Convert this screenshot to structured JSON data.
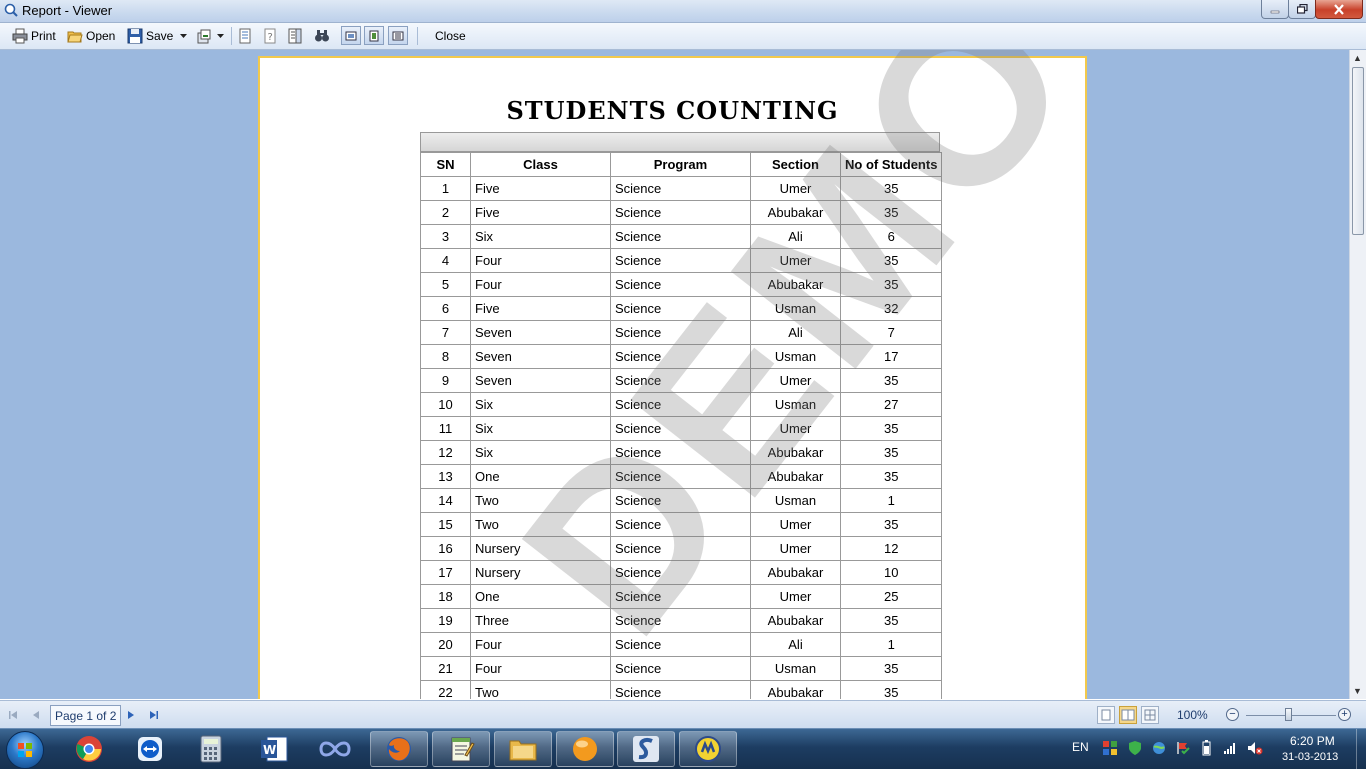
{
  "window": {
    "title": "Report - Viewer"
  },
  "toolbar": {
    "print_label": "Print",
    "open_label": "Open",
    "save_label": "Save",
    "close_label": "Close"
  },
  "report": {
    "title": "STUDENTS COUNTING",
    "columns": [
      "SN",
      "Class",
      "Program",
      "Section",
      "No of Students"
    ],
    "rows": [
      [
        "1",
        "Five",
        "Science",
        "Umer",
        "35"
      ],
      [
        "2",
        "Five",
        "Science",
        "Abubakar",
        "35"
      ],
      [
        "3",
        "Six",
        "Science",
        "Ali",
        "6"
      ],
      [
        "4",
        "Four",
        "Science",
        "Umer",
        "35"
      ],
      [
        "5",
        "Four",
        "Science",
        "Abubakar",
        "35"
      ],
      [
        "6",
        "Five",
        "Science",
        "Usman",
        "32"
      ],
      [
        "7",
        "Seven",
        "Science",
        "Ali",
        "7"
      ],
      [
        "8",
        "Seven",
        "Science",
        "Usman",
        "17"
      ],
      [
        "9",
        "Seven",
        "Science",
        "Umer",
        "35"
      ],
      [
        "10",
        "Six",
        "Science",
        "Usman",
        "27"
      ],
      [
        "11",
        "Six",
        "Science",
        "Umer",
        "35"
      ],
      [
        "12",
        "Six",
        "Science",
        "Abubakar",
        "35"
      ],
      [
        "13",
        "One",
        "Science",
        "Abubakar",
        "35"
      ],
      [
        "14",
        "Two",
        "Science",
        "Usman",
        "1"
      ],
      [
        "15",
        "Two",
        "Science",
        "Umer",
        "35"
      ],
      [
        "16",
        "Nursery",
        "Science",
        "Umer",
        "12"
      ],
      [
        "17",
        "Nursery",
        "Science",
        "Abubakar",
        "10"
      ],
      [
        "18",
        "One",
        "Science",
        "Umer",
        "25"
      ],
      [
        "19",
        "Three",
        "Science",
        "Abubakar",
        "35"
      ],
      [
        "20",
        "Four",
        "Science",
        "Ali",
        "1"
      ],
      [
        "21",
        "Four",
        "Science",
        "Usman",
        "35"
      ],
      [
        "22",
        "Two",
        "Science",
        "Abubakar",
        "35"
      ]
    ],
    "watermark": "DEMO"
  },
  "statusbar": {
    "page_indicator": "Page 1 of 2",
    "zoom": "100%"
  },
  "taskbar": {
    "language": "EN",
    "time": "6:20 PM",
    "date": "31-03-2013"
  },
  "colors": {
    "viewer_background": "#9bb8de",
    "page_border": "#f2c94c",
    "taskbar": "#1d3d62"
  }
}
